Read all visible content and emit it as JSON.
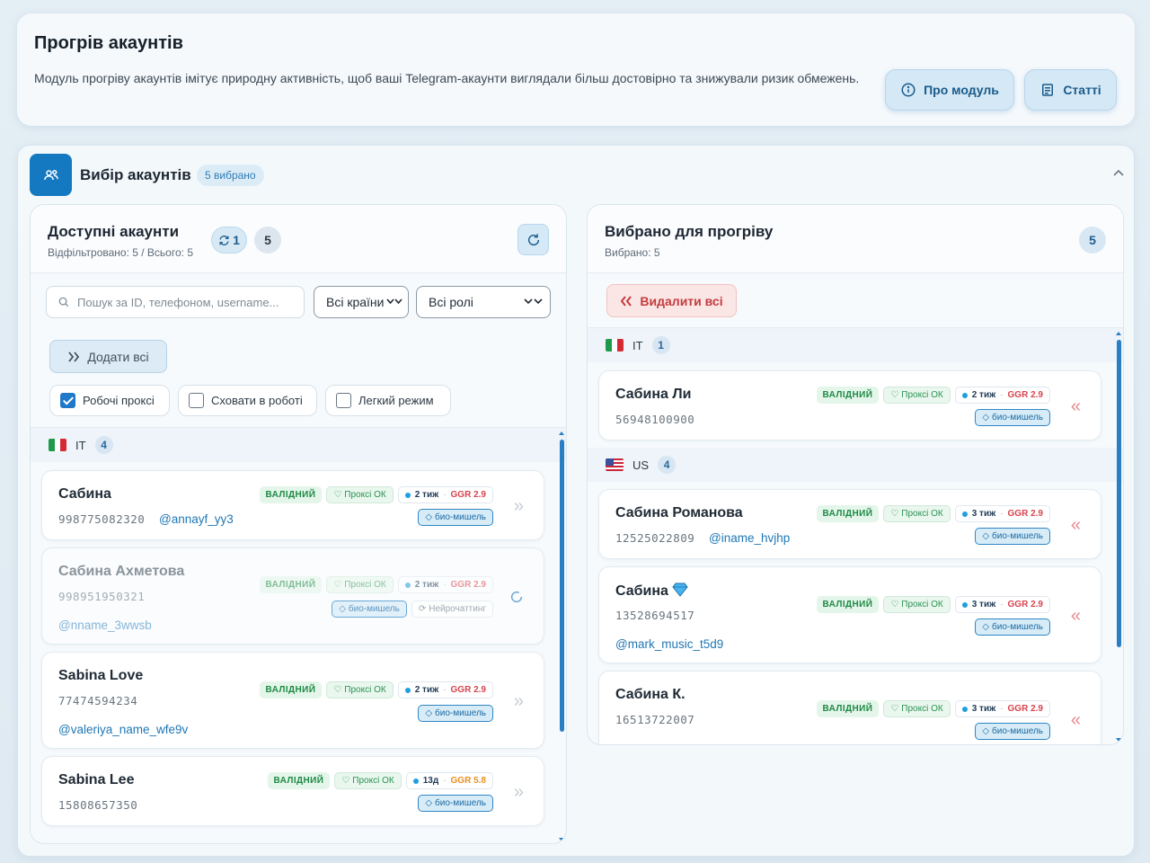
{
  "header": {
    "title": "Прогрів акаунтів",
    "description": "Модуль прогріву акаунтів імітує природну активність, щоб ваші Telegram-акаунти виглядали більш достовірно та знижували ризик обмежень.",
    "about_label": "Про модуль",
    "articles_label": "Статті"
  },
  "selection": {
    "title": "Вибір акаунтів",
    "badge": "5 вибрано"
  },
  "available": {
    "title": "Доступні акаунти",
    "subtitle": "Відфільтровано: 5 / Всього: 5",
    "refresh_count": "1",
    "count": "5",
    "search_placeholder": "Пошук за ID, телефоном, username...",
    "country_select": "Всі країни",
    "roles_select": "Всі ролі",
    "add_all_label": "Додати всі",
    "checkboxes": [
      {
        "label": "Робочі проксі",
        "checked": true
      },
      {
        "label": "Сховати в роботі",
        "checked": false
      },
      {
        "label": "Легкий режим",
        "checked": false
      }
    ],
    "group": {
      "country": "IT",
      "count": "4"
    },
    "accounts": [
      {
        "name": "Сабина",
        "phone": "998775082320",
        "username": "@annayf_yy3",
        "status": "ВАЛІДНИЙ",
        "proxy": "Проксі ОК",
        "age": "2 тиж",
        "ggr_label": "GGR",
        "ggr": "2.9",
        "tags": [
          "био-мишель"
        ]
      },
      {
        "name": "Сабина Ахметова",
        "phone": "998951950321",
        "username": "@nname_3wwsb",
        "status": "ВАЛІДНИЙ",
        "proxy": "Проксі ОК",
        "age": "2 тиж",
        "ggr_label": "GGR",
        "ggr": "2.9",
        "tags": [
          "био-мишель",
          "Нейрочаттинг"
        ]
      },
      {
        "name": "Sabina Love",
        "phone": "77474594234",
        "username": "@valeriya_name_wfe9v",
        "status": "ВАЛІДНИЙ",
        "proxy": "Проксі ОК",
        "age": "2 тиж",
        "ggr_label": "GGR",
        "ggr": "2.9",
        "tags": [
          "био-мишель"
        ]
      },
      {
        "name": "Sabina Lee",
        "phone": "15808657350",
        "status": "ВАЛІДНИЙ",
        "proxy": "Проксі ОК",
        "age": "13д",
        "ggr_label": "GGR",
        "ggr": "5.8",
        "tags": [
          "био-мишель"
        ]
      }
    ]
  },
  "selected": {
    "title": "Вибрано для прогріву",
    "subtitle": "Вибрано: 5",
    "count": "5",
    "remove_all_label": "Видалити всі",
    "groups": [
      {
        "country": "IT",
        "count": "1"
      },
      {
        "country": "US",
        "count": "4"
      }
    ],
    "accounts": [
      {
        "name": "Сабина Ли",
        "phone": "56948100900",
        "status": "ВАЛІДНИЙ",
        "proxy": "Проксі ОК",
        "age": "2 тиж",
        "ggr_label": "GGR",
        "ggr": "2.9",
        "tags": [
          "био-мишель"
        ]
      },
      {
        "name": "Сабина Романова",
        "phone": "12525022809",
        "username": "@iname_hvjhp",
        "status": "ВАЛІДНИЙ",
        "proxy": "Проксі ОК",
        "age": "3 тиж",
        "ggr_label": "GGR",
        "ggr": "2.9",
        "tags": [
          "био-мишель"
        ]
      },
      {
        "name": "Сабина",
        "phone": "13528694517",
        "username": "@mark_music_t5d9",
        "status": "ВАЛІДНИЙ",
        "proxy": "Проксі ОК",
        "age": "3 тиж",
        "ggr_label": "GGR",
        "ggr": "2.9",
        "tags": [
          "био-мишель"
        ]
      },
      {
        "name": "Сабина К.",
        "phone": "16513722007",
        "status": "ВАЛІДНИЙ",
        "proxy": "Проксі ОК",
        "age": "3 тиж",
        "ggr_label": "GGR",
        "ggr": "2.9",
        "tags": [
          "био-мишель"
        ]
      }
    ]
  },
  "colors": {
    "accent": "#1479c1",
    "valid": "#1f8a45",
    "ggr_red": "#d6454f",
    "ggr_orange": "#e69022",
    "danger": "#c53b3e"
  }
}
